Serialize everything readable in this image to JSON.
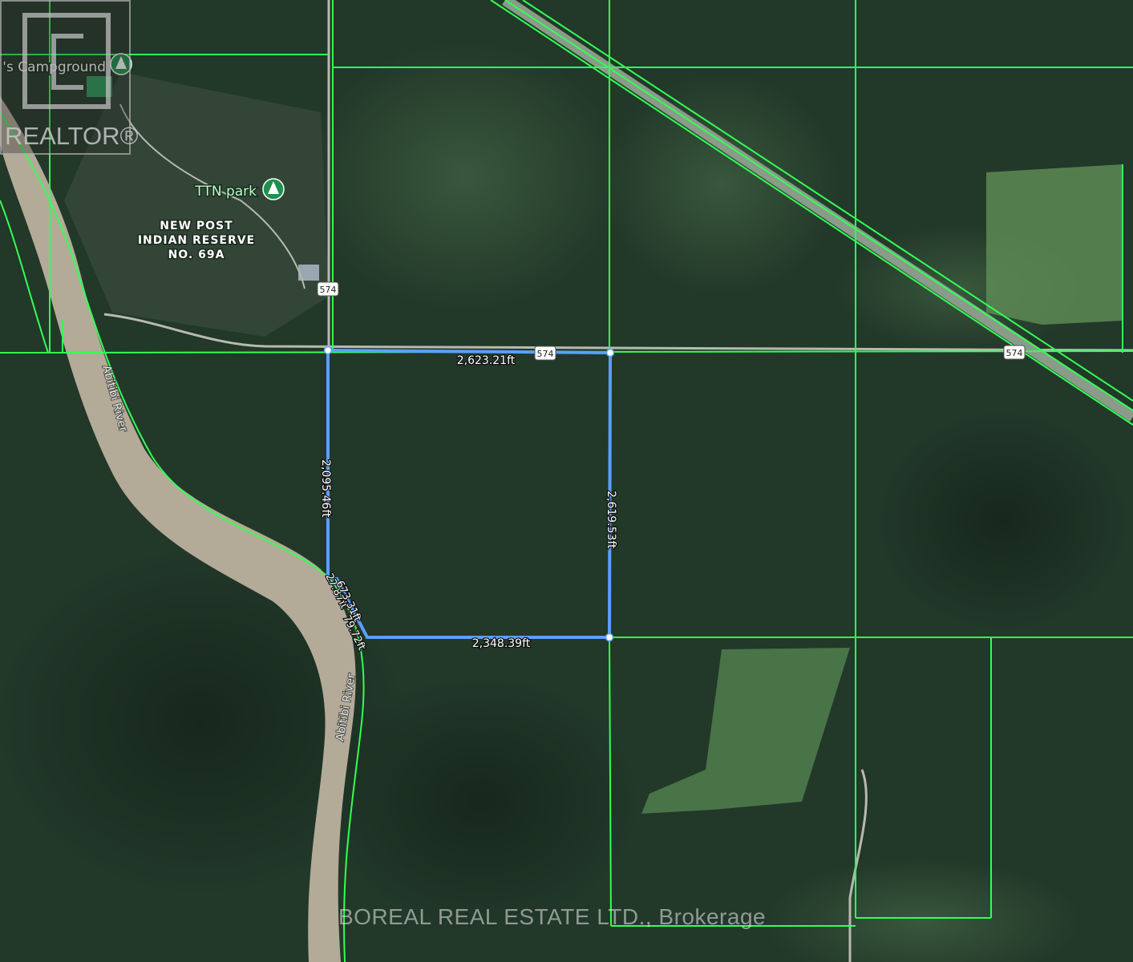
{
  "map_labels": {
    "campground": "'s Campground",
    "park": "TTN park",
    "reserve_line1": "NEW POST",
    "reserve_line2": "INDIAN RESERVE",
    "reserve_line3": "NO. 69A",
    "river_1": "Abitibi River",
    "river_2": "Abitibi River"
  },
  "road_shields": {
    "shield_1": "574",
    "shield_2": "574",
    "shield_3": "574"
  },
  "measurements": {
    "top": "2,623.21ft",
    "left": "2,095.46ft",
    "right": "2,619.53ft",
    "bottom": "2,348.39ft",
    "diagonal_1": "27.87ft",
    "diagonal_2": "673.31ft",
    "diagonal_3": "79.72ft"
  },
  "logo": {
    "text": "REALTOR®"
  },
  "watermark": "BOREAL REAL ESTATE LTD., Brokerage",
  "colors": {
    "forest_dark": "#1f3326",
    "forest_mid": "#2c4a33",
    "field_light": "#5f8a58",
    "river": "#b3aa98",
    "lot_line": "#33ff55",
    "measure": "#5aa0ff",
    "road": "#b9b9b0"
  }
}
